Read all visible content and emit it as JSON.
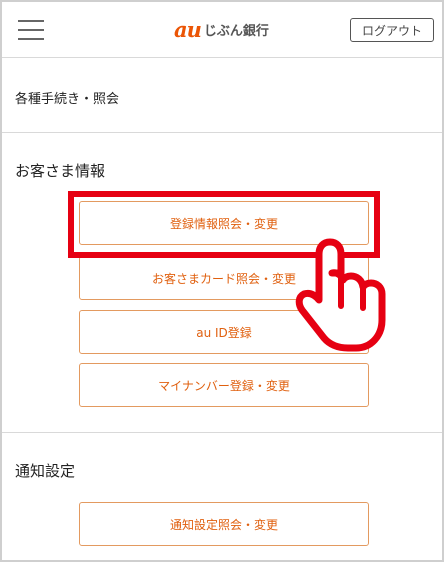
{
  "header": {
    "logo_au": "au",
    "logo_text": "じぶん銀行",
    "logout_label": "ログアウト"
  },
  "procedures": {
    "label": "各種手続き・照会"
  },
  "customer_info": {
    "title": "お客さま情報",
    "buttons": [
      "登録情報照会・変更",
      "お客さまカード照会・変更",
      "au ID登録",
      "マイナンバー登録・変更"
    ]
  },
  "notifications": {
    "title": "通知設定",
    "buttons": [
      "通知設定照会・変更"
    ]
  },
  "colors": {
    "brand_orange": "#eb5505",
    "highlight_red": "#e60012"
  },
  "icons": {
    "menu": "hamburger-menu-icon",
    "pointer": "pointing-hand-icon"
  }
}
